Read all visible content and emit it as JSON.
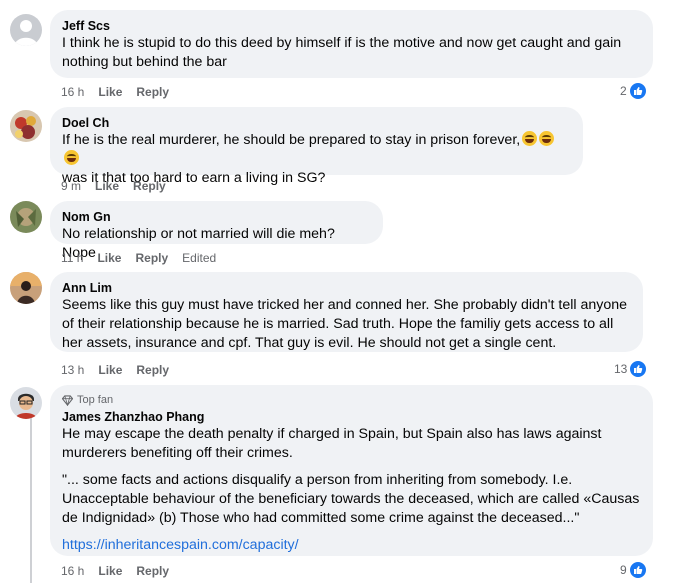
{
  "comments": [
    {
      "author": "Jeff Scs",
      "text": "I think he is stupid to do this deed by himself if is the motive and now get caught and gain nothing but behind the bar",
      "time": "16 h",
      "like": "Like",
      "reply": "Reply",
      "reaction_count": "2"
    },
    {
      "author": "Doel Ch",
      "text": "If he is the real murderer, he should be prepared to stay in prison forever,",
      "text2": "was it that too hard to earn a living in SG?",
      "emojis": [
        "rolling-on-floor-laughing",
        "rolling-on-floor-laughing",
        "rolling-on-floor-laughing"
      ],
      "time": "9 m",
      "like": "Like",
      "reply": "Reply"
    },
    {
      "author": "Nom Gn",
      "text": "No relationship or not married will die meh? Nope",
      "time": "11 h",
      "like": "Like",
      "reply": "Reply",
      "edited": "Edited"
    },
    {
      "author": "Ann Lim",
      "text": "Seems like this guy must have tricked her and conned her. She probably didn't tell anyone of their relationship because he is married. Sad truth. Hope the familiy gets access to all her assets, insurance and cpf. That guy is evil. He should not get a single cent.",
      "time": "13 h",
      "like": "Like",
      "reply": "Reply",
      "reaction_count": "13"
    },
    {
      "badge": "Top fan",
      "author": "James Zhanzhao Phang",
      "text": "He may escape the death penalty if charged in Spain, but Spain also has laws against murderers benefiting off their crimes.",
      "quote": "\"... some facts and actions disqualify a person from inheriting from somebody. I.e. Unacceptable behaviour of the beneficiary towards the deceased, which are called «Causas de Indignidad» (b) Those who had committed some crime against the deceased...\"",
      "link": "https://inheritancespain.com/capacity/",
      "time": "16 h",
      "like": "Like",
      "reply": "Reply",
      "reaction_count": "9"
    }
  ],
  "colors": {
    "bubble": "#f0f2f5",
    "meta": "#65676b",
    "link": "#216fdb",
    "like_blue": "#1877f2"
  }
}
